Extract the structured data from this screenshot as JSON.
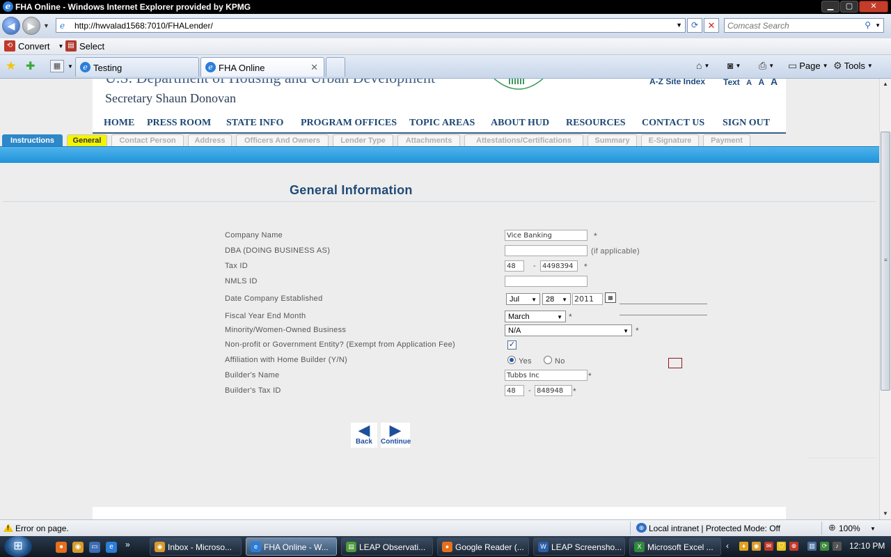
{
  "window": {
    "title": "FHA Online - Windows Internet Explorer provided by KPMG",
    "minimize": "▁",
    "maximize": "▢",
    "close": "✕"
  },
  "address_bar": {
    "url": "http://hwvalad1568:7010/FHALender/",
    "search_placeholder": "Comcast Search"
  },
  "toolbar": {
    "convert_label": "Convert",
    "select_label": "Select"
  },
  "browser_tabs": [
    {
      "label": "Testing",
      "active": false
    },
    {
      "label": "FHA Online",
      "active": true
    }
  ],
  "command_bar": {
    "page_label": "Page",
    "tools_label": "Tools"
  },
  "hud_header": {
    "department": "U.S. Department of Housing and Urban Development",
    "secretary": "Secretary Shaun Donovan",
    "site_index": "A-Z Site Index",
    "text_label": "Text",
    "text_sizes": [
      "A",
      "A",
      "A"
    ],
    "nav": [
      "HOME",
      "PRESS ROOM",
      "STATE INFO",
      "PROGRAM OFFICES",
      "TOPIC AREAS",
      "ABOUT HUD",
      "RESOURCES",
      "CONTACT US",
      "SIGN OUT"
    ]
  },
  "wizard_tabs": [
    {
      "label": "Instructions",
      "state": "done"
    },
    {
      "label": "General",
      "state": "current"
    },
    {
      "label": "Contact Person",
      "state": "disabled"
    },
    {
      "label": "Address",
      "state": "disabled"
    },
    {
      "label": "Officers And Owners",
      "state": "disabled"
    },
    {
      "label": "Lender Type",
      "state": "disabled"
    },
    {
      "label": "Attachments",
      "state": "disabled"
    },
    {
      "label": "Attestations/Certifications",
      "state": "disabled"
    },
    {
      "label": "Summary",
      "state": "disabled"
    },
    {
      "label": "E-Signature",
      "state": "disabled"
    },
    {
      "label": "Payment",
      "state": "disabled"
    }
  ],
  "form": {
    "title": "General Information",
    "required_mark": "*",
    "company_name": {
      "label": "Company Name",
      "value": "Vice Banking"
    },
    "dba": {
      "label": "DBA (DOING BUSINESS AS)",
      "value": "",
      "hint": "(if applicable)"
    },
    "tax_id": {
      "label": "Tax ID",
      "prefix": "48",
      "suffix": "4498394"
    },
    "nmls_id": {
      "label": "NMLS ID",
      "value": ""
    },
    "date_established": {
      "label": "Date Company Established",
      "month": "Jul",
      "day": "28",
      "year": "2011"
    },
    "fiscal_year_end": {
      "label": "Fiscal Year End Month",
      "value": "March"
    },
    "minority_owned": {
      "label": "Minority/Women-Owned Business",
      "value": "N/A"
    },
    "nonprofit": {
      "label": "Non-profit or Government Entity? (Exempt from Application Fee)",
      "checked": true
    },
    "affiliation": {
      "label": "Affiliation with Home Builder (Y/N)",
      "yes_label": "Yes",
      "no_label": "No",
      "selected": "Yes"
    },
    "builder_name": {
      "label": "Builder's Name",
      "value": "Tubbs Inc"
    },
    "builder_tax_id": {
      "label": "Builder's Tax ID",
      "prefix": "48",
      "suffix": "848948"
    }
  },
  "buttons": {
    "back": "Back",
    "continue": "Continue"
  },
  "status_bar": {
    "message": "Error on page.",
    "zone": "Local intranet | Protected Mode: Off",
    "zoom": "100%"
  },
  "taskbar": {
    "tasks": [
      {
        "label": "Inbox - Microso...",
        "active": false
      },
      {
        "label": "FHA Online - W...",
        "active": true
      },
      {
        "label": "LEAP Observati...",
        "active": false
      },
      {
        "label": "Google Reader (...",
        "active": false
      },
      {
        "label": "LEAP Screensho...",
        "active": false
      },
      {
        "label": "Microsoft Excel ...",
        "active": false
      }
    ],
    "clock": "12:10 PM"
  },
  "colors": {
    "hud_blue": "#1c4775",
    "wizard_band": "#1f93d8",
    "current_tab": "#f4f400"
  }
}
